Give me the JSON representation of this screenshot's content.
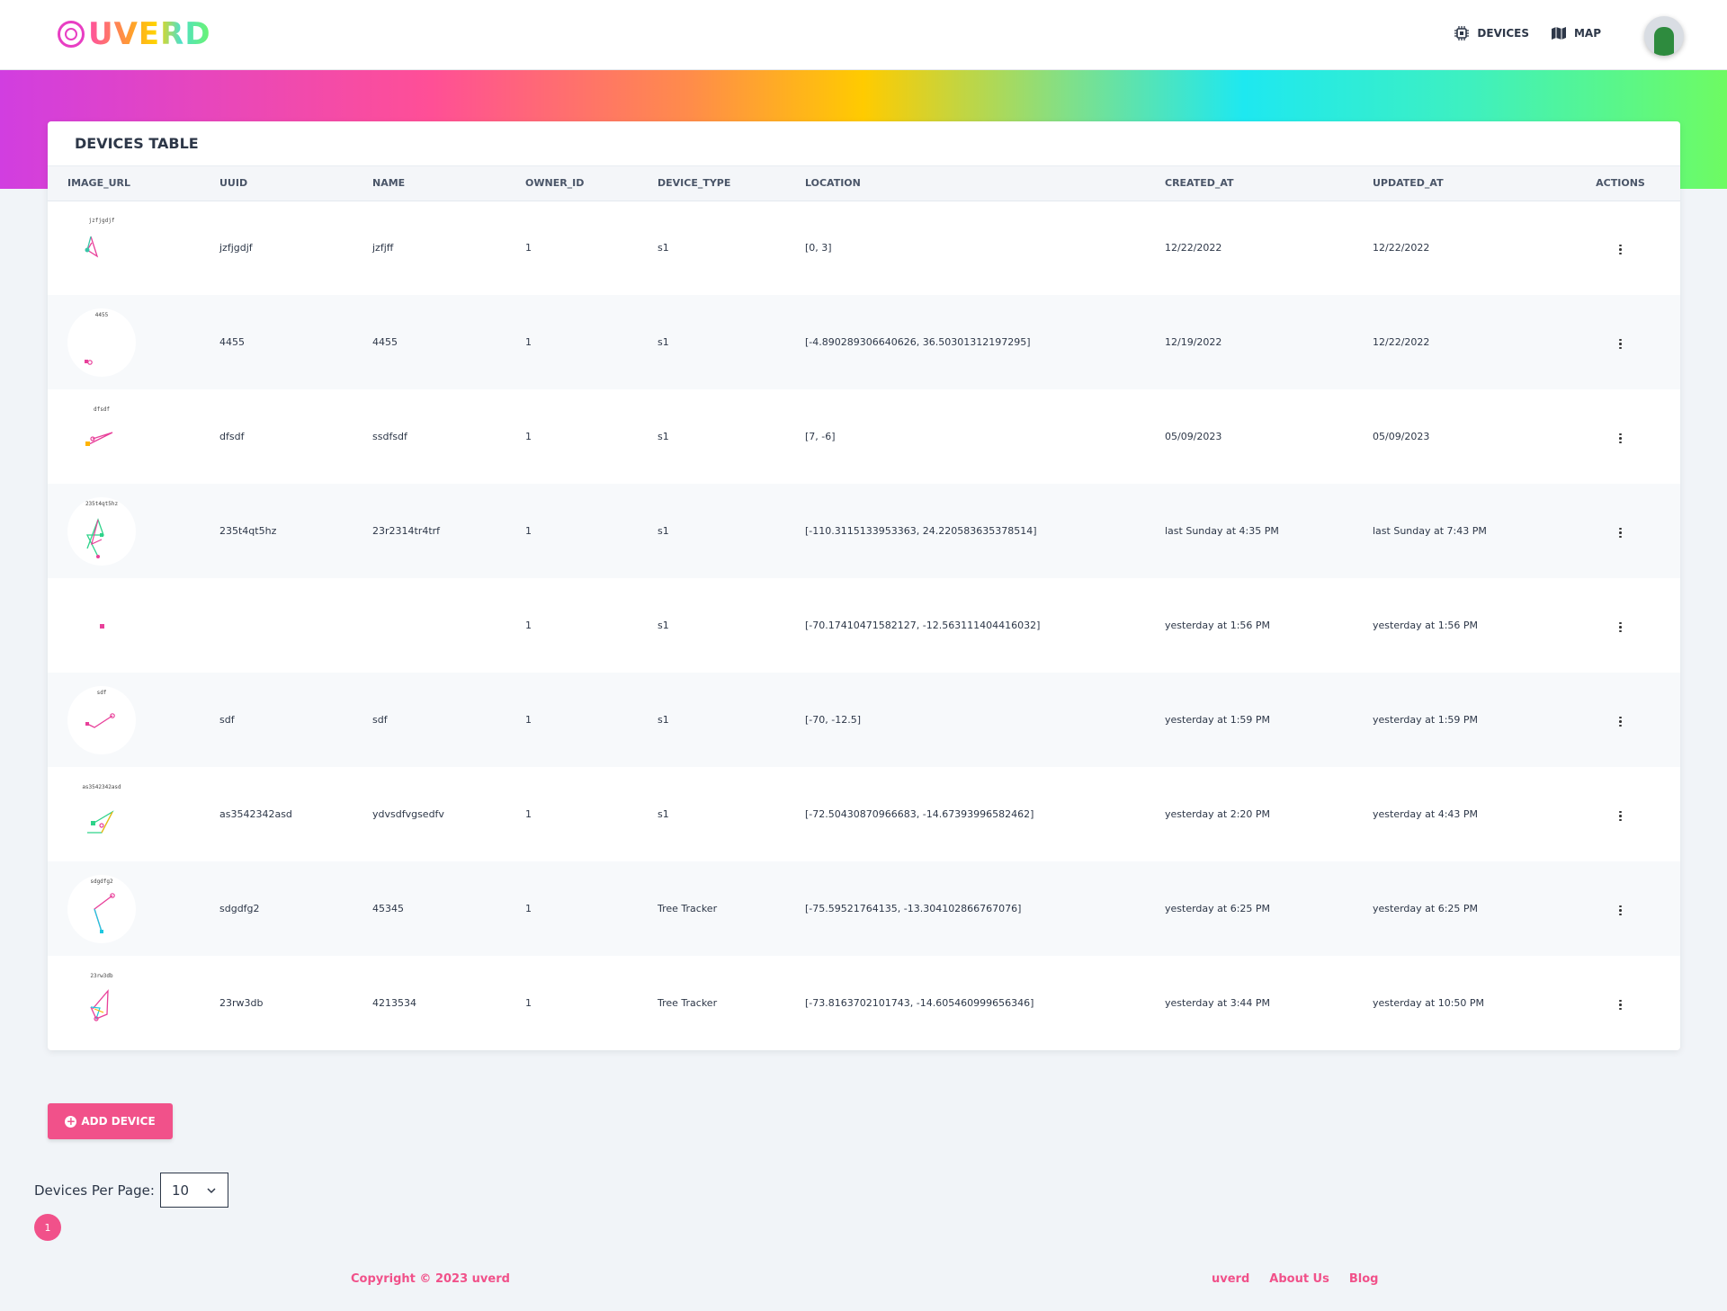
{
  "brand": {
    "logo_text": "UVERD",
    "accent": "#f1518a"
  },
  "nav": {
    "devices_label": "DEVICES",
    "map_label": "MAP",
    "devices_icon": "chip-icon",
    "map_icon": "map-icon"
  },
  "table": {
    "title": "DEVICES TABLE",
    "headers": [
      "IMAGE_URL",
      "UUID",
      "NAME",
      "OWNER_ID",
      "DEVICE_TYPE",
      "LOCATION",
      "CREATED_AT",
      "UPDATED_AT",
      "ACTIONS"
    ],
    "rows": [
      {
        "thumb_label": "jzfjgdjf",
        "uuid": "jzfjgdjf",
        "name": "jzfjff",
        "owner_id": "1",
        "device_type": "s1",
        "location": "[0, 3]",
        "created_at": "12/22/2022",
        "updated_at": "12/22/2022"
      },
      {
        "thumb_label": "4455",
        "uuid": "4455",
        "name": "4455",
        "owner_id": "1",
        "device_type": "s1",
        "location": "[-4.890289306640626, 36.50301312197295]",
        "created_at": "12/19/2022",
        "updated_at": "12/22/2022"
      },
      {
        "thumb_label": "dfsdf",
        "uuid": "dfsdf",
        "name": "ssdfsdf",
        "owner_id": "1",
        "device_type": "s1",
        "location": "[7, -6]",
        "created_at": "05/09/2023",
        "updated_at": "05/09/2023"
      },
      {
        "thumb_label": "235t4qt5hz",
        "uuid": "235t4qt5hz",
        "name": "23r2314tr4trf",
        "owner_id": "1",
        "device_type": "s1",
        "location": "[-110.3115133953363, 24.220583635378514]",
        "created_at": "last Sunday at 4:35 PM",
        "updated_at": "last Sunday at 7:43 PM"
      },
      {
        "thumb_label": "",
        "uuid": "",
        "name": "",
        "owner_id": "1",
        "device_type": "s1",
        "location": "[-70.17410471582127, -12.563111404416032]",
        "created_at": "yesterday at 1:56 PM",
        "updated_at": "yesterday at 1:56 PM"
      },
      {
        "thumb_label": "sdf",
        "uuid": "sdf",
        "name": "sdf",
        "owner_id": "1",
        "device_type": "s1",
        "location": "[-70, -12.5]",
        "created_at": "yesterday at 1:59 PM",
        "updated_at": "yesterday at 1:59 PM"
      },
      {
        "thumb_label": "as3542342asd",
        "uuid": "as3542342asd",
        "name": "ydvsdfvgsedfv",
        "owner_id": "1",
        "device_type": "s1",
        "location": "[-72.50430870966683, -14.67393996582462]",
        "created_at": "yesterday at 2:20 PM",
        "updated_at": "yesterday at 4:43 PM"
      },
      {
        "thumb_label": "sdgdfg2",
        "uuid": "sdgdfg2",
        "name": "45345",
        "owner_id": "1",
        "device_type": "Tree Tracker",
        "location": "[-75.59521764135, -13.304102866767076]",
        "created_at": "yesterday at 6:25 PM",
        "updated_at": "yesterday at 6:25 PM"
      },
      {
        "thumb_label": "23rw3db",
        "uuid": "23rw3db",
        "name": "4213534",
        "owner_id": "1",
        "device_type": "Tree Tracker",
        "location": "[-73.8163702101743, -14.605460999656346]",
        "created_at": "yesterday at 3:44 PM",
        "updated_at": "yesterday at 10:50 PM"
      }
    ]
  },
  "controls": {
    "add_device_label": "ADD DEVICE",
    "per_page_label": "Devices Per Page:",
    "per_page_value": "10",
    "current_page": "1"
  },
  "footer": {
    "copyright": "Copyright © 2023 uverd",
    "links": [
      "uverd",
      "About Us",
      "Blog"
    ]
  }
}
